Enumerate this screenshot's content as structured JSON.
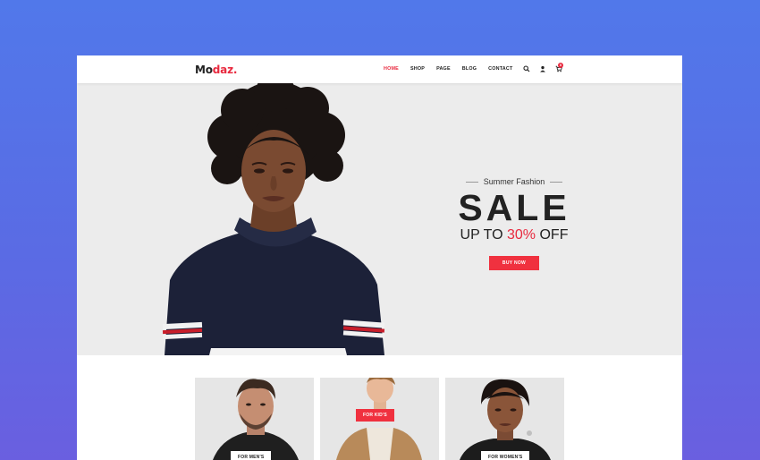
{
  "logo": {
    "prefix": "Mo",
    "accent": "daz."
  },
  "nav": {
    "items": [
      {
        "label": "HOME",
        "active": true
      },
      {
        "label": "SHOP",
        "active": false
      },
      {
        "label": "PAGE",
        "active": false
      },
      {
        "label": "BLOG",
        "active": false
      },
      {
        "label": "CONTACT",
        "active": false
      }
    ]
  },
  "header_icons": {
    "search": "search-icon",
    "user": "user-icon",
    "cart": "cart-icon",
    "cart_count": "0"
  },
  "hero": {
    "subtitle": "Summer Fashion",
    "title": "SALE",
    "offer_prefix": "UP TO",
    "offer_percent": "30%",
    "offer_suffix": "OFF",
    "button_label": "BUY NOW"
  },
  "categories": [
    {
      "label": "FOR MEN'S"
    },
    {
      "label": "FOR KID'S"
    },
    {
      "label": "FOR WOMEN'S"
    }
  ],
  "colors": {
    "accent": "#e8293e",
    "background_gradient_top": "#5178ea",
    "background_gradient_bottom": "#6a5fe0",
    "hero_bg": "#ececec"
  }
}
